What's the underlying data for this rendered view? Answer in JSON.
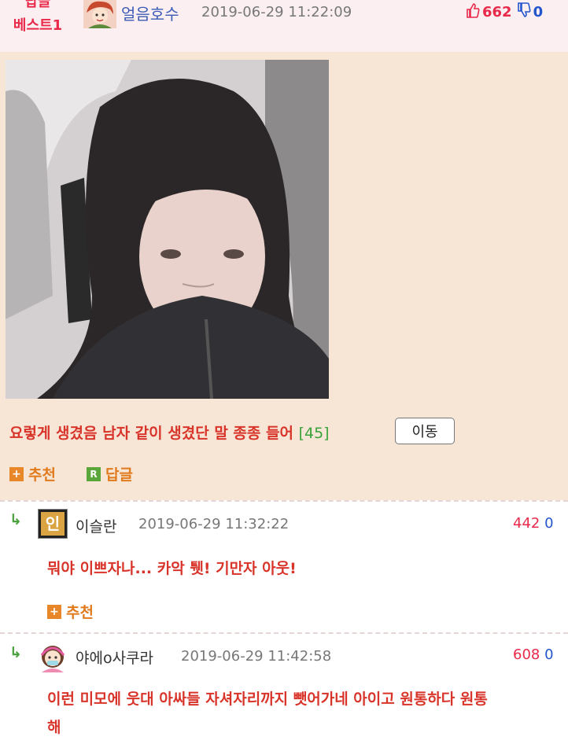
{
  "best_post": {
    "badge_line1": "답글",
    "badge_line2": "베스트1",
    "nickname": "얼음호수",
    "datetime": "2019-06-29 11:22:09",
    "upvotes": "662",
    "downvotes": "0",
    "content": "요렇게 생겼음 남자 같이 생겼단 말 종종 들어",
    "reply_count": "[45]",
    "move_label": "이동",
    "recommend_label": "추천",
    "reply_label": "답글",
    "reply_icon_letter": "R"
  },
  "comments": [
    {
      "arrow": "↳",
      "nickname": "이슬란",
      "avatar_text": "인",
      "datetime": "2019-06-29 11:32:22",
      "upvotes": "442",
      "downvotes": "0",
      "text": "뭐야 이쁘자나... 카악 퉷! 기만자 아웃!",
      "recommend_label": "추천"
    },
    {
      "arrow": "↳",
      "nickname": "야에o사쿠라",
      "datetime": "2019-06-29 11:42:58",
      "upvotes": "608",
      "downvotes": "0",
      "text_line1": "이런 미모에 웃대 아싸들 자셔자리까지 뺏어가네 아이고 원통하다 원통",
      "text_line2": "해"
    }
  ],
  "colors": {
    "accent_red": "#e8294a",
    "post_bg": "#f7e6d6",
    "green": "#4aa23e",
    "orange": "#e07a1d"
  }
}
